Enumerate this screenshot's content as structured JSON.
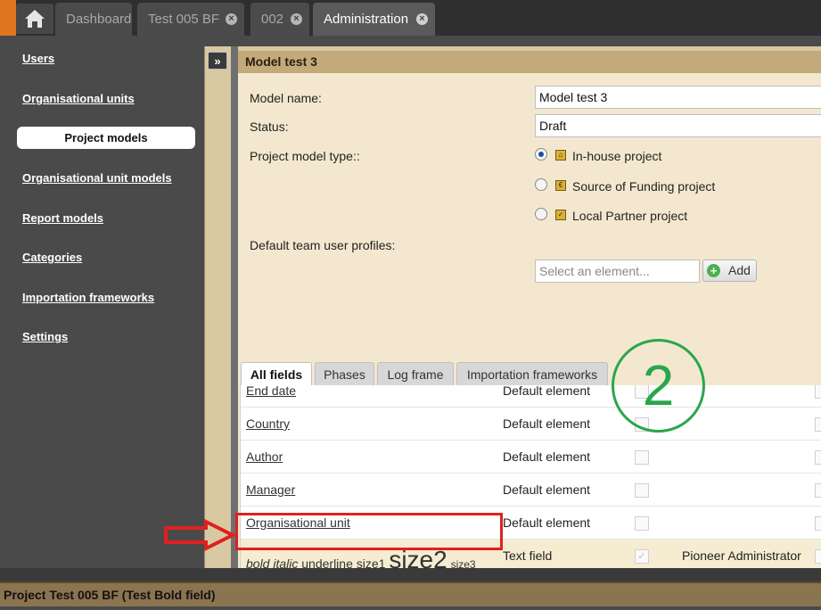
{
  "tabs": [
    {
      "label": "Dashboard"
    },
    {
      "label": "Test 005 BF",
      "close": "×"
    },
    {
      "label": "002",
      "close": "×"
    },
    {
      "label": "Administration",
      "close": "×"
    }
  ],
  "sidebar": {
    "items": [
      {
        "label": "Users"
      },
      {
        "label": "Organisational units"
      },
      {
        "label": "Project models"
      },
      {
        "label": "Organisational unit models"
      },
      {
        "label": "Report models"
      },
      {
        "label": "Categories"
      },
      {
        "label": "Importation frameworks"
      },
      {
        "label": "Settings"
      }
    ],
    "selected": "Project models"
  },
  "collapse_button": "»",
  "panel": {
    "title": "Model test 3",
    "model_name_label": "Model name:",
    "model_name_value": "Model test 3",
    "status_label": "Status:",
    "status_value": "Draft",
    "type_label": "Project model type::",
    "types": [
      {
        "label": "In-house project",
        "checked": true
      },
      {
        "label": "Source of Funding project",
        "checked": false
      },
      {
        "label": "Local Partner project",
        "checked": false
      }
    ],
    "profiles_label": "Default team user profiles:",
    "select_placeholder": "Select an element...",
    "add_label": "Add",
    "add_icon": "+"
  },
  "subtabs": [
    {
      "label": "All fields",
      "active": true
    },
    {
      "label": "Phases"
    },
    {
      "label": "Log frame"
    },
    {
      "label": "Importation frameworks"
    }
  ],
  "grid_rows": [
    {
      "name": "End date",
      "type": "Default element"
    },
    {
      "name": "Country",
      "type": "Default element"
    },
    {
      "name": "Author",
      "type": "Default element"
    },
    {
      "name": "Manager",
      "type": "Default element"
    },
    {
      "name": "Organisational unit",
      "type": "Default element"
    }
  ],
  "highlight_row": {
    "bold_italic": "bold italic",
    "underline_size1": "underline size1",
    "size2": "size2",
    "size3": "size3",
    "type": "Text field",
    "check": "✓",
    "profile": "Pioneer Administrator"
  },
  "scrollbar": {
    "left": "◀",
    "grip": "|||"
  },
  "annotation_number": "2",
  "bottom_bar": "Project Test 005 BF (Test Bold field)",
  "colors": {
    "accent": "#e0761e",
    "panel_header": "#c2aa7a",
    "annotation_red": "#e02020",
    "annotation_green": "#2aa64b"
  }
}
